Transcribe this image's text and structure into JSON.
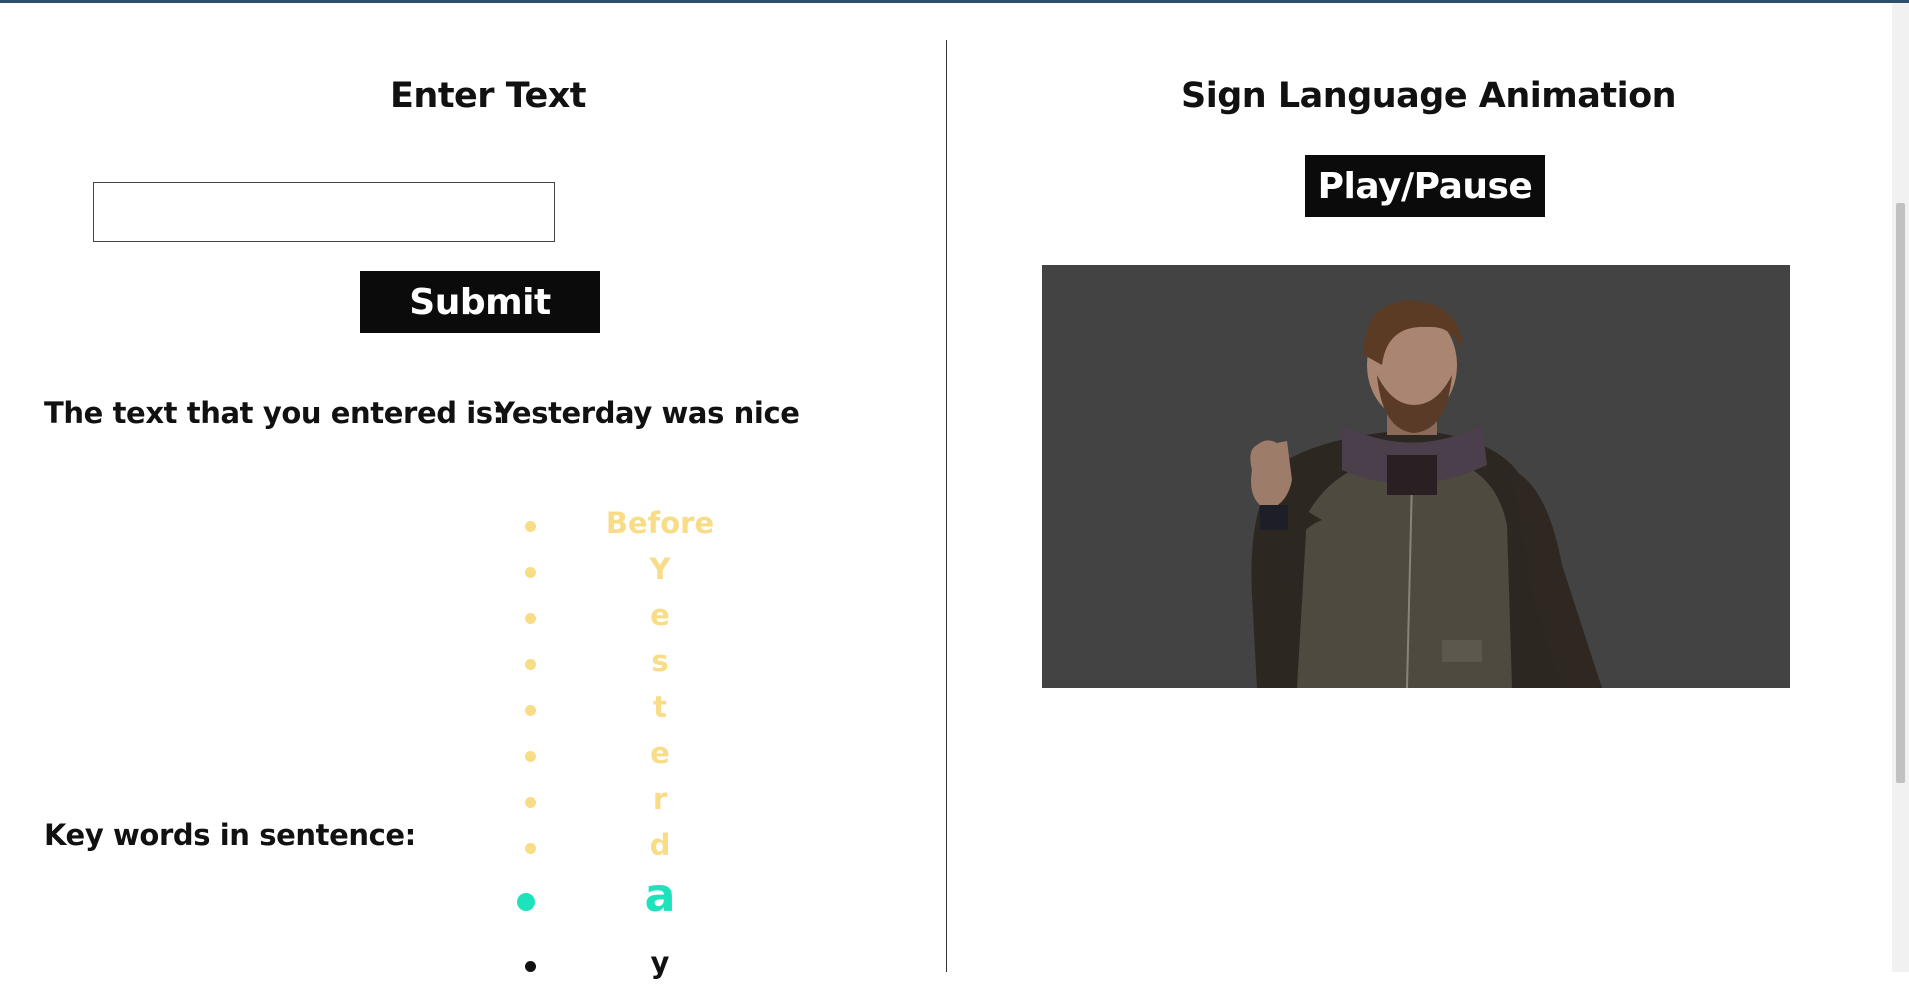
{
  "left": {
    "heading": "Enter Text",
    "input": {
      "value": "",
      "placeholder": ""
    },
    "submit_label": "Submit",
    "entered_label": "The text that you entered is:",
    "entered_value": "Yesterday was nice",
    "keywords_label": "Key words in sentence:",
    "keywords": [
      {
        "text": "Before",
        "state": "past"
      },
      {
        "text": "Y",
        "state": "past"
      },
      {
        "text": "e",
        "state": "past"
      },
      {
        "text": "s",
        "state": "past"
      },
      {
        "text": "t",
        "state": "past"
      },
      {
        "text": "e",
        "state": "past"
      },
      {
        "text": "r",
        "state": "past"
      },
      {
        "text": "d",
        "state": "past"
      },
      {
        "text": "a",
        "state": "current"
      },
      {
        "text": "y",
        "state": "next"
      }
    ]
  },
  "right": {
    "heading": "Sign Language Animation",
    "play_pause_label": "Play/Pause"
  },
  "colors": {
    "past_keyword": "#f8dc86",
    "current_keyword": "#1de3bc",
    "video_background": "#434343",
    "button_background": "#0b0b0b",
    "top_bar": "#2e4f6b"
  }
}
